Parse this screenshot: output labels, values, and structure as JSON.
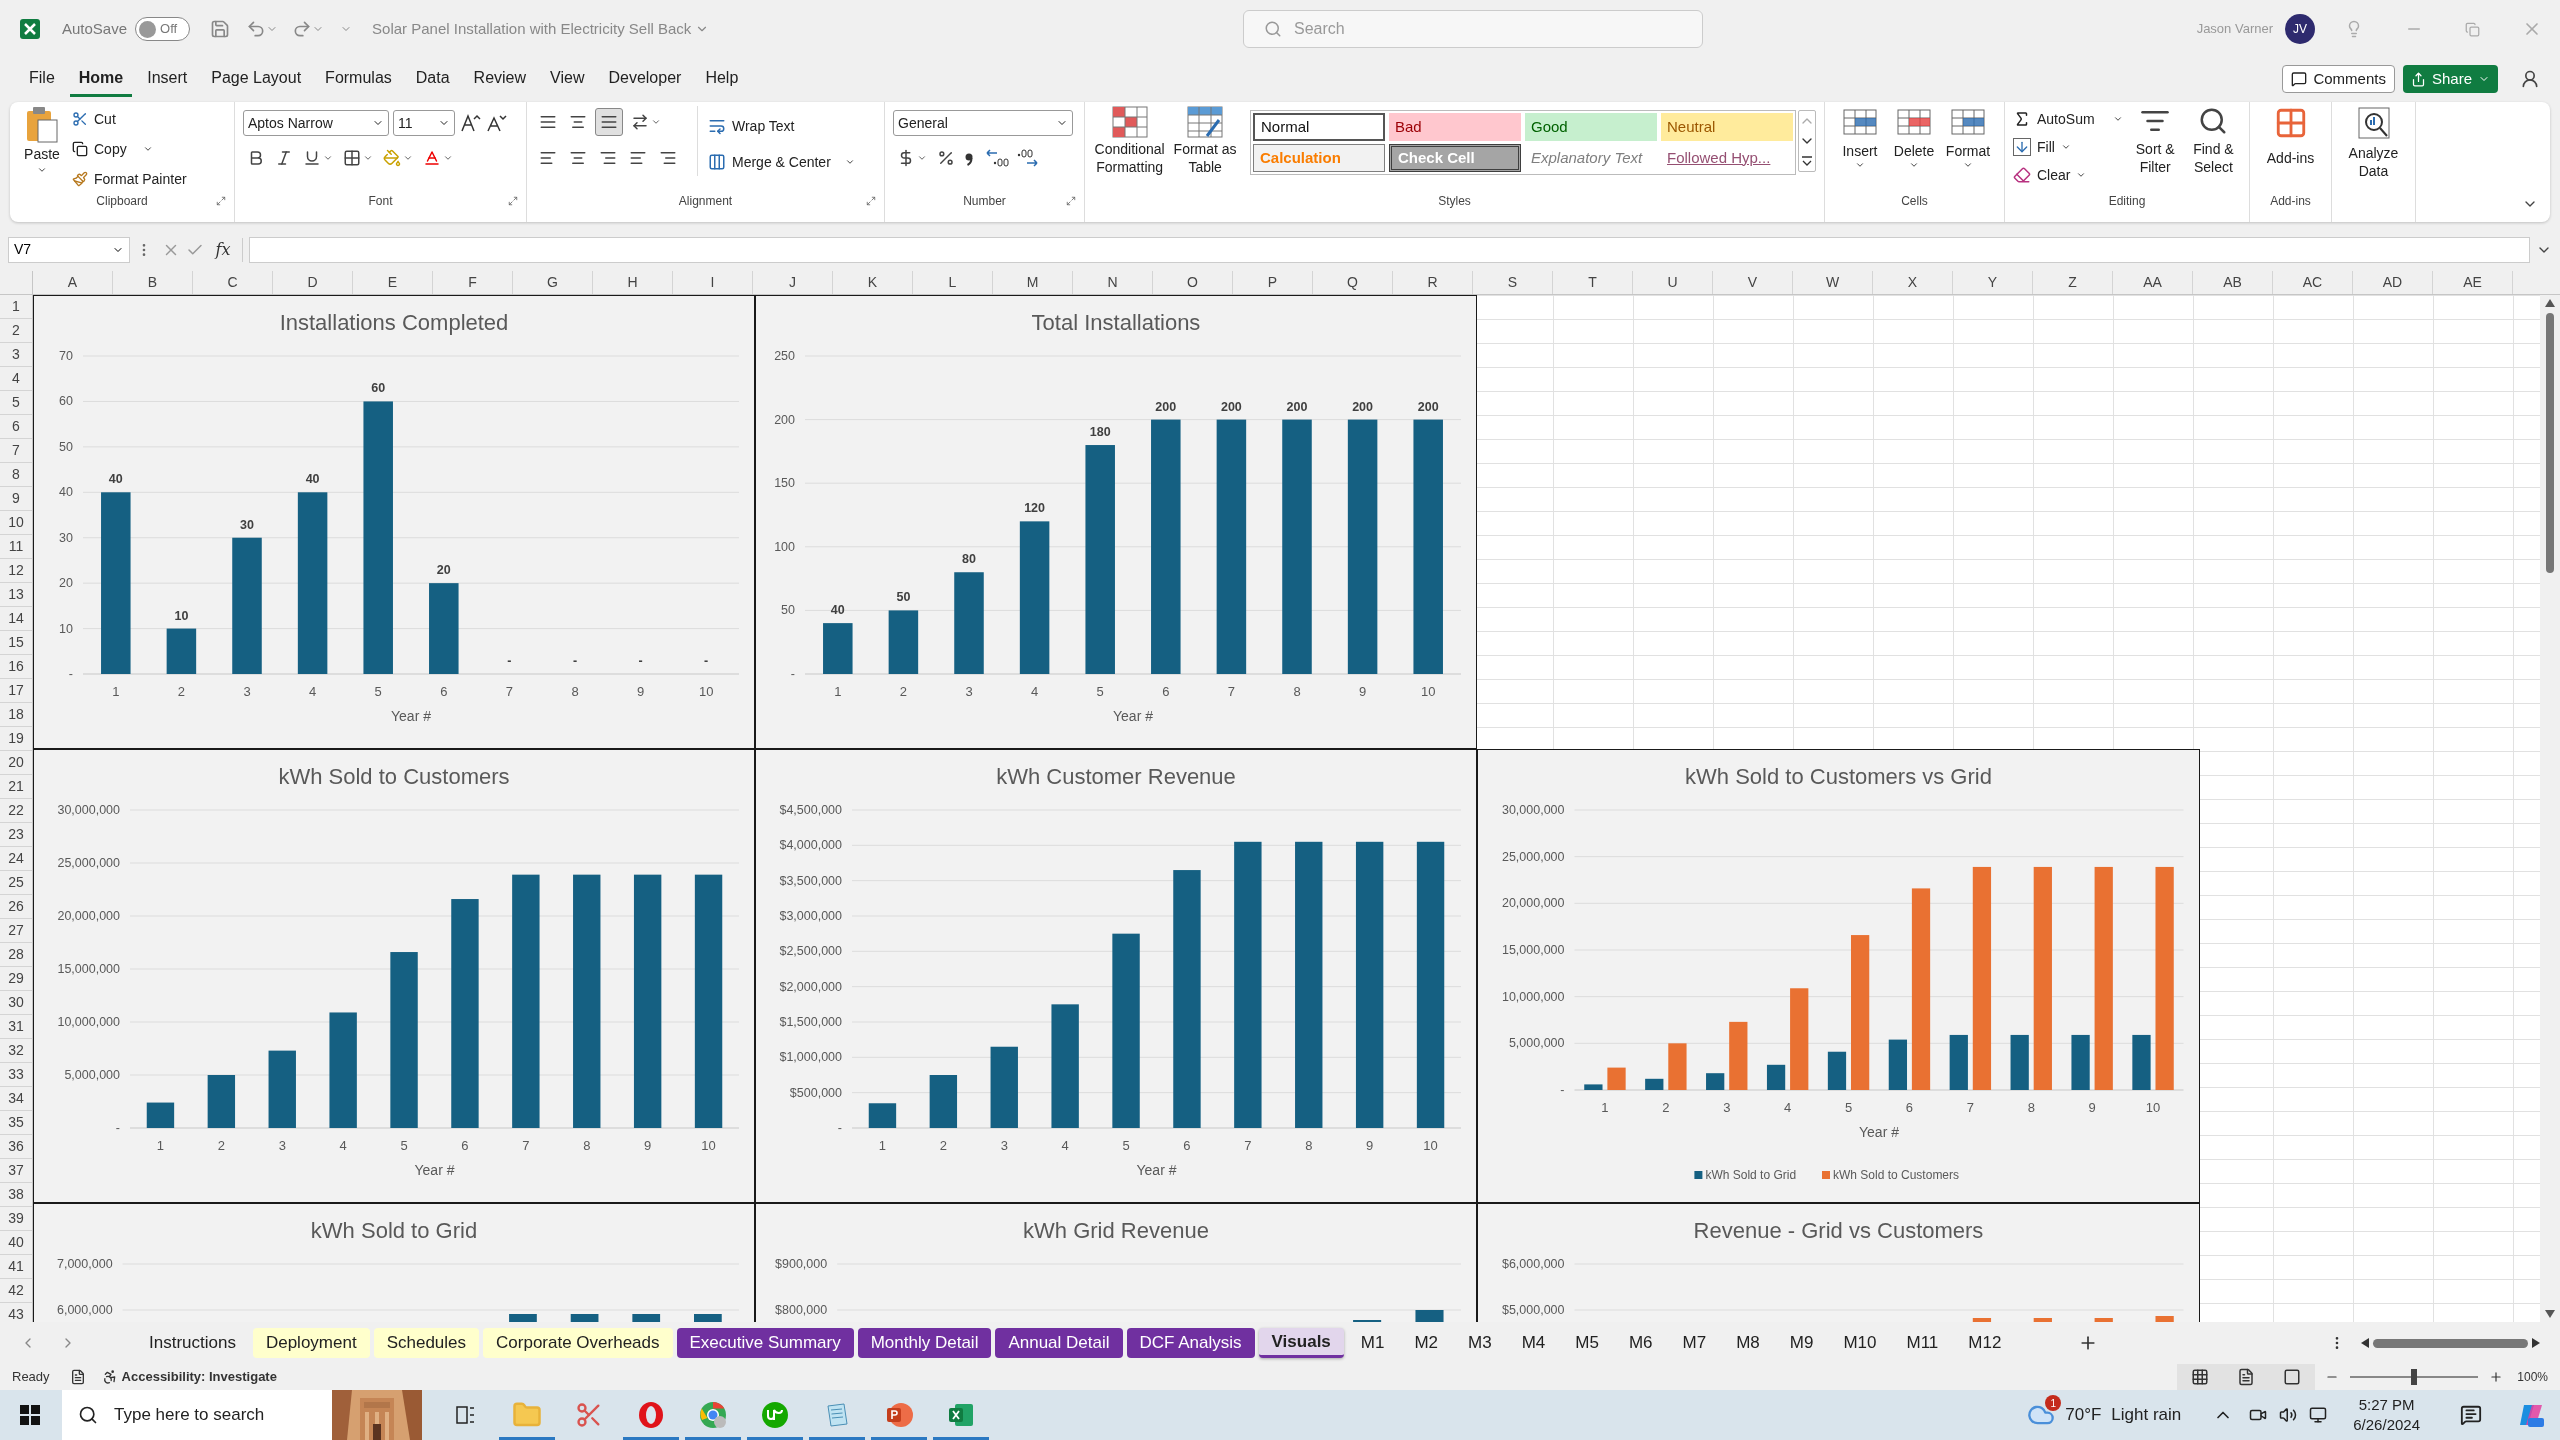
{
  "title_bar": {
    "autosave": {
      "label": "AutoSave",
      "state_text": "Off",
      "on": false
    },
    "document_title": "Solar Panel Installation with Electricity Sell Back",
    "search_placeholder": "Search",
    "user_name": "Jason Varner",
    "user_initials": "JV"
  },
  "menu_tabs": [
    {
      "label": "File",
      "selected": false
    },
    {
      "label": "Home",
      "selected": true
    },
    {
      "label": "Insert",
      "selected": false
    },
    {
      "label": "Page Layout",
      "selected": false
    },
    {
      "label": "Formulas",
      "selected": false
    },
    {
      "label": "Data",
      "selected": false
    },
    {
      "label": "Review",
      "selected": false
    },
    {
      "label": "View",
      "selected": false
    },
    {
      "label": "Developer",
      "selected": false
    },
    {
      "label": "Help",
      "selected": false
    }
  ],
  "comments_button": "Comments",
  "share_button": "Share",
  "ribbon": {
    "clipboard": {
      "paste": "Paste",
      "cut": "Cut",
      "copy": "Copy",
      "format_painter": "Format Painter",
      "label": "Clipboard"
    },
    "font": {
      "font_name": "Aptos Narrow",
      "font_size": "11",
      "label": "Font"
    },
    "alignment": {
      "wrap_text": "Wrap Text",
      "merge_center": "Merge & Center",
      "label": "Alignment"
    },
    "number": {
      "format": "General",
      "label": "Number"
    },
    "styles": {
      "conditional_formatting": "Conditional Formatting",
      "format_as_table": "Format as Table",
      "cells": [
        {
          "label": "Normal",
          "kind": "normal"
        },
        {
          "label": "Bad",
          "kind": "bad"
        },
        {
          "label": "Good",
          "kind": "good"
        },
        {
          "label": "Neutral",
          "kind": "neutral"
        },
        {
          "label": "Calculation",
          "kind": "calculation"
        },
        {
          "label": "Check Cell",
          "kind": "check"
        },
        {
          "label": "Explanatory Text",
          "kind": "explanatory"
        },
        {
          "label": "Followed Hyp...",
          "kind": "followed"
        }
      ],
      "label": "Styles"
    },
    "cells": {
      "insert": "Insert",
      "delete": "Delete",
      "format": "Format",
      "label": "Cells"
    },
    "editing": {
      "autosum": "AutoSum",
      "fill": "Fill",
      "clear": "Clear",
      "sort_filter": "Sort & Filter",
      "find_select": "Find & Select",
      "label": "Editing"
    },
    "addins": {
      "button": "Add-ins",
      "label": "Add-ins"
    },
    "analyze": {
      "button": "Analyze Data"
    }
  },
  "formula_bar": {
    "name_box": "V7",
    "function_label": "fx"
  },
  "column_headers": [
    "A",
    "B",
    "C",
    "D",
    "E",
    "F",
    "G",
    "H",
    "I",
    "J",
    "K",
    "L",
    "M",
    "N",
    "O",
    "P",
    "Q",
    "R",
    "S",
    "T",
    "U",
    "V",
    "W",
    "X",
    "Y",
    "Z",
    "AA",
    "AB",
    "AC",
    "AD",
    "AE"
  ],
  "row_headers": [
    "1",
    "2",
    "3",
    "4",
    "5",
    "6",
    "7",
    "8",
    "9",
    "10",
    "11",
    "12",
    "13",
    "14",
    "15",
    "16",
    "17",
    "18",
    "19",
    "20",
    "21",
    "22",
    "23",
    "24",
    "25",
    "26",
    "27",
    "28",
    "29",
    "30",
    "31",
    "32",
    "33",
    "34",
    "35",
    "36",
    "37",
    "38",
    "39",
    "40",
    "41",
    "42",
    "43"
  ],
  "charts": [
    {
      "kind": "full",
      "chart_data": {
        "type": "bar",
        "title": "Installations Completed",
        "xlabel": "Year #",
        "categories": [
          "1",
          "2",
          "3",
          "4",
          "5",
          "6",
          "7",
          "8",
          "9",
          "10"
        ],
        "series": [
          {
            "color": "#156082",
            "values": [
              40,
              10,
              30,
              40,
              60,
              20,
              0,
              0,
              0,
              0
            ]
          }
        ],
        "grid": true,
        "ylim": [
          0,
          70
        ],
        "yticks": [
          {
            "value": 0,
            "label": "-"
          },
          {
            "value": 10,
            "label": "10"
          },
          {
            "value": 20,
            "label": "20"
          },
          {
            "value": 30,
            "label": "30"
          },
          {
            "value": 40,
            "label": "40"
          },
          {
            "value": 50,
            "label": "50"
          },
          {
            "value": 60,
            "label": "60"
          },
          {
            "value": 70,
            "label": "70"
          }
        ],
        "value_labels": [
          "40",
          "10",
          "30",
          "40",
          "60",
          "20",
          "-",
          "-",
          "-",
          "-"
        ]
      }
    },
    {
      "kind": "full",
      "chart_data": {
        "type": "bar",
        "title": "Total Installations",
        "xlabel": "Year #",
        "categories": [
          "1",
          "2",
          "3",
          "4",
          "5",
          "6",
          "7",
          "8",
          "9",
          "10"
        ],
        "series": [
          {
            "color": "#156082",
            "values": [
              40,
              50,
              80,
              120,
              180,
              200,
              200,
              200,
              200,
              200
            ]
          }
        ],
        "grid": true,
        "ylim": [
          0,
          250
        ],
        "yticks": [
          {
            "value": 0,
            "label": "-"
          },
          {
            "value": 50,
            "label": "50"
          },
          {
            "value": 100,
            "label": "100"
          },
          {
            "value": 150,
            "label": "150"
          },
          {
            "value": 200,
            "label": "200"
          },
          {
            "value": 250,
            "label": "250"
          }
        ],
        "value_labels": [
          "40",
          "50",
          "80",
          "120",
          "180",
          "200",
          "200",
          "200",
          "200",
          "200"
        ]
      }
    },
    {
      "kind": "empty"
    },
    {
      "kind": "full",
      "chart_data": {
        "type": "bar",
        "title": "kWh Sold to Customers",
        "xlabel": "Year #",
        "categories": [
          "1",
          "2",
          "3",
          "4",
          "5",
          "6",
          "7",
          "8",
          "9",
          "10"
        ],
        "series": [
          {
            "color": "#156082",
            "values": [
              2400000,
              5000000,
              7300000,
              10900000,
              16600000,
              21600000,
              23900000,
              23900000,
              23900000,
              23900000
            ]
          }
        ],
        "grid": true,
        "ylim": [
          0,
          30000000
        ],
        "yticks": [
          {
            "value": 0,
            "label": "-"
          },
          {
            "value": 5000000,
            "label": "5,000,000"
          },
          {
            "value": 10000000,
            "label": "10,000,000"
          },
          {
            "value": 15000000,
            "label": "15,000,000"
          },
          {
            "value": 20000000,
            "label": "20,000,000"
          },
          {
            "value": 25000000,
            "label": "25,000,000"
          },
          {
            "value": 30000000,
            "label": "30,000,000"
          }
        ]
      }
    },
    {
      "kind": "full",
      "chart_data": {
        "type": "bar",
        "title": "kWh Customer Revenue",
        "xlabel": "Year #",
        "categories": [
          "1",
          "2",
          "3",
          "4",
          "5",
          "6",
          "7",
          "8",
          "9",
          "10"
        ],
        "series": [
          {
            "color": "#156082",
            "values": [
              350000,
              750000,
              1150000,
              1750000,
              2750000,
              3650000,
              4050000,
              4050000,
              4050000,
              4050000
            ]
          }
        ],
        "grid": true,
        "ylim": [
          0,
          4500000
        ],
        "yticks": [
          {
            "value": 0,
            "label": "-"
          },
          {
            "value": 500000,
            "label": "$500,000"
          },
          {
            "value": 1000000,
            "label": "$1,000,000"
          },
          {
            "value": 1500000,
            "label": "$1,500,000"
          },
          {
            "value": 2000000,
            "label": "$2,000,000"
          },
          {
            "value": 2500000,
            "label": "$2,500,000"
          },
          {
            "value": 3000000,
            "label": "$3,000,000"
          },
          {
            "value": 3500000,
            "label": "$3,500,000"
          },
          {
            "value": 4000000,
            "label": "$4,000,000"
          },
          {
            "value": 4500000,
            "label": "$4,500,000"
          }
        ]
      }
    },
    {
      "kind": "full",
      "chart_data": {
        "type": "bar",
        "title": "kWh Sold to Customers vs Grid",
        "xlabel": "Year #",
        "categories": [
          "1",
          "2",
          "3",
          "4",
          "5",
          "6",
          "7",
          "8",
          "9",
          "10"
        ],
        "series": [
          {
            "name": "kWh Sold to Grid",
            "color": "#156082",
            "values": [
              600000,
              1200000,
              1800000,
              2700000,
              4100000,
              5400000,
              5900000,
              5900000,
              5900000,
              5900000
            ]
          },
          {
            "name": "kWh Sold to Customers",
            "color": "#e97132",
            "values": [
              2400000,
              5000000,
              7300000,
              10900000,
              16600000,
              21600000,
              23900000,
              23900000,
              23900000,
              23900000
            ]
          }
        ],
        "grid": true,
        "legend": true,
        "ylim": [
          0,
          30000000
        ],
        "yticks": [
          {
            "value": 0,
            "label": "-"
          },
          {
            "value": 5000000,
            "label": "5,000,000"
          },
          {
            "value": 10000000,
            "label": "10,000,000"
          },
          {
            "value": 15000000,
            "label": "15,000,000"
          },
          {
            "value": 20000000,
            "label": "20,000,000"
          },
          {
            "value": 25000000,
            "label": "25,000,000"
          },
          {
            "value": 30000000,
            "label": "30,000,000"
          }
        ]
      }
    },
    {
      "kind": "partial",
      "title": "kWh Sold to Grid",
      "ytick_labels": [
        "7,000,000",
        "6,000,000"
      ]
    },
    {
      "kind": "partial",
      "title": "kWh Grid Revenue",
      "ytick_labels": [
        "$900,000",
        "$800,000"
      ]
    },
    {
      "kind": "partial",
      "title": "Revenue - Grid vs Customers",
      "ytick_labels": [
        "$6,000,000",
        "$5,000,000"
      ]
    }
  ],
  "sheet_tabs": [
    {
      "label": "Instructions",
      "selected": false
    },
    {
      "label": "Deployment",
      "color": "#ffffcc",
      "selected": false
    },
    {
      "label": "Schedules",
      "color": "#ffffcc",
      "selected": false
    },
    {
      "label": "Corporate Overheads",
      "color": "#ffffcc",
      "selected": false
    },
    {
      "label": "Executive Summary",
      "color": "#7030a0",
      "selected": false
    },
    {
      "label": "Monthly Detail",
      "color": "#7030a0",
      "selected": false
    },
    {
      "label": "Annual Detail",
      "color": "#7030a0",
      "selected": false
    },
    {
      "label": "DCF Analysis",
      "color": "#7030a0",
      "selected": false
    },
    {
      "label": "Visuals",
      "color": "#7030a0",
      "selected": true
    },
    {
      "label": "M1",
      "selected": false
    },
    {
      "label": "M2",
      "selected": false
    },
    {
      "label": "M3",
      "selected": false
    },
    {
      "label": "M4",
      "selected": false
    },
    {
      "label": "M5",
      "selected": false
    },
    {
      "label": "M6",
      "selected": false
    },
    {
      "label": "M7",
      "selected": false
    },
    {
      "label": "M8",
      "selected": false
    },
    {
      "label": "M9",
      "selected": false
    },
    {
      "label": "M10",
      "selected": false
    },
    {
      "label": "M11",
      "selected": false
    },
    {
      "label": "M12",
      "selected": false
    }
  ],
  "status_bar": {
    "ready": "Ready",
    "accessibility": "Accessibility: Investigate",
    "zoom": "100%",
    "zoom_level": {
      "level": 0.5
    }
  },
  "taskbar": {
    "search_placeholder": "Type here to search",
    "apps": [
      {
        "kind": "task_view",
        "running": false
      },
      {
        "kind": "explorer",
        "running": true
      },
      {
        "kind": "snip",
        "running": false
      },
      {
        "kind": "opera",
        "running": true
      },
      {
        "kind": "chrome",
        "running": true
      },
      {
        "kind": "upwork",
        "running": true
      },
      {
        "kind": "notepad",
        "running": true
      },
      {
        "kind": "powerpoint",
        "running": true
      },
      {
        "kind": "excel",
        "running": true
      }
    ],
    "weather_badge": "1",
    "temperature": "70°F",
    "weather": "Light rain",
    "time": "5:27 PM",
    "date": "6/26/2024"
  }
}
